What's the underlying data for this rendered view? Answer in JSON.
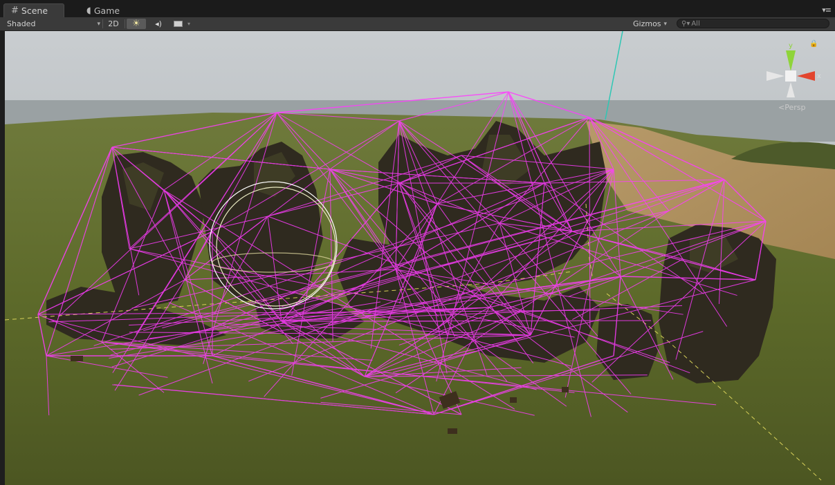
{
  "tabs": [
    {
      "label": "Scene",
      "icon": "hash-icon",
      "active": true
    },
    {
      "label": "Game",
      "icon": "pacman-icon",
      "active": false
    }
  ],
  "toolbar": {
    "shading_mode": "Shaded",
    "mode_2d_label": "2D",
    "lighting_icon": "sun-icon",
    "audio_icon": "speaker-icon",
    "effects_icon": "image-icon",
    "gizmos_label": "Gizmos",
    "search_placeholder": "All"
  },
  "viewport": {
    "projection_label": "Persp",
    "axis_labels": {
      "y": "y",
      "x": "x"
    }
  },
  "colors": {
    "navmesh": "#ff3cff",
    "axis_y": "#8fd43a",
    "axis_x": "#e2452e",
    "axis_line": "#2ec7b4"
  }
}
